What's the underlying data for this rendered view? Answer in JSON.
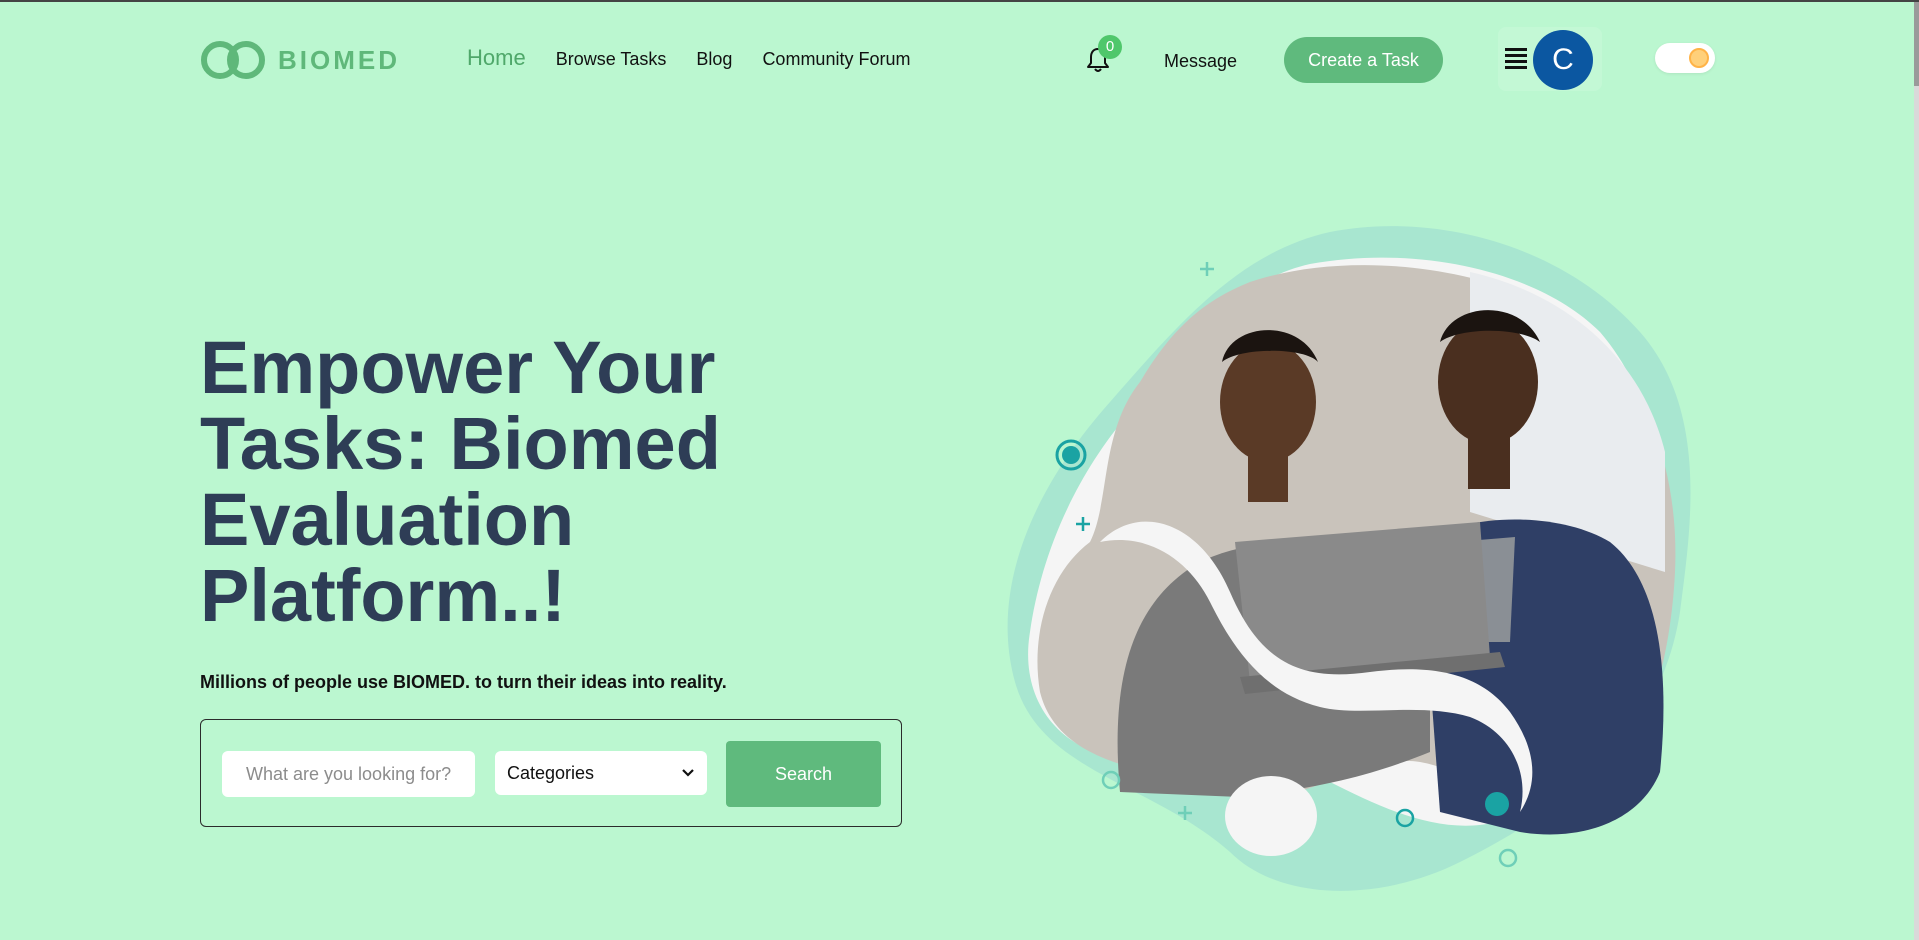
{
  "brand": {
    "name": "BIOMED",
    "color": "#5fb87a"
  },
  "nav": {
    "items": [
      {
        "label": "Home",
        "active": true
      },
      {
        "label": "Browse Tasks",
        "active": false
      },
      {
        "label": "Blog",
        "active": false
      },
      {
        "label": "Community Forum",
        "active": false
      }
    ]
  },
  "header": {
    "notification_count": "0",
    "message_label": "Message",
    "create_task_label": "Create a Task",
    "avatar_initial": "C",
    "menu_icon": "hamburger-icon",
    "theme_toggle_icon": "sun-toggle-icon"
  },
  "hero": {
    "title": "Empower Your Tasks: Biomed Evaluation Platform..!",
    "subtitle": "Millions of people use BIOMED. to turn their ideas into reality."
  },
  "search": {
    "placeholder": "What are you looking for?",
    "category_selected": "Categories",
    "button_label": "Search"
  },
  "colors": {
    "background": "#bbf7d0",
    "accent": "#5fba7d",
    "title": "#2e3d56",
    "avatar": "#0b57a1",
    "blob_light": "#a8e6d0",
    "teal_decor": "#1aa3a3"
  }
}
